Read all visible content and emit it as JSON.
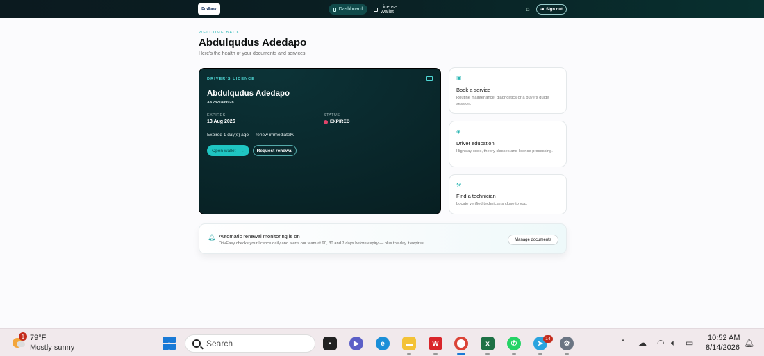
{
  "nav": {
    "logo_text": "DrivEasy",
    "dashboard_label": "Dashboard",
    "wallet_label": "License Wallet",
    "signout_label": "Sign out"
  },
  "header": {
    "welcome": "WELCOME BACK",
    "name": "Abdulqudus Adedapo",
    "subtitle": "Here's the health of your documents and services."
  },
  "licence": {
    "label": "DRIVER'S LICENCE",
    "name": "Abdulqudus Adedapo",
    "number": "AK2821889928",
    "expires_label": "EXPIRES",
    "expires_value": "13 Aug 2026",
    "status_label": "STATUS",
    "status_value": "EXPIRED",
    "message": "Expired 1 day(s) ago — renew immediately.",
    "open_wallet": "Open wallet",
    "request_renewal": "Request renewal",
    "status_color": "#e0446a"
  },
  "services": [
    {
      "title": "Book a service",
      "desc": "Routine maintenance, diagnostics or a buyers guide session.",
      "icon": "calendar-icon"
    },
    {
      "title": "Driver education",
      "desc": "Highway code, theory classes and licence processing.",
      "icon": "graduation-cap-icon"
    },
    {
      "title": "Find a technician",
      "desc": "Locate verified technicians close to you.",
      "icon": "wrench-icon"
    }
  ],
  "banner": {
    "title": "Automatic renewal monitoring is on",
    "desc": "DrivEasy checks your licence daily and alerts our team at 90, 30 and 7 days before expiry — plus the day it expires.",
    "manage_label": "Manage documents"
  },
  "taskbar": {
    "weather_badge": "1",
    "temperature": "79°F",
    "condition": "Mostly sunny",
    "search_placeholder": "Search",
    "telegram_badge": "14",
    "time": "10:52 AM",
    "date": "8/14/2026"
  },
  "colors": {
    "accent": "#1fc5c2",
    "nav_bg": "#0b1a1f",
    "card_bg": "#0a2a2e"
  }
}
